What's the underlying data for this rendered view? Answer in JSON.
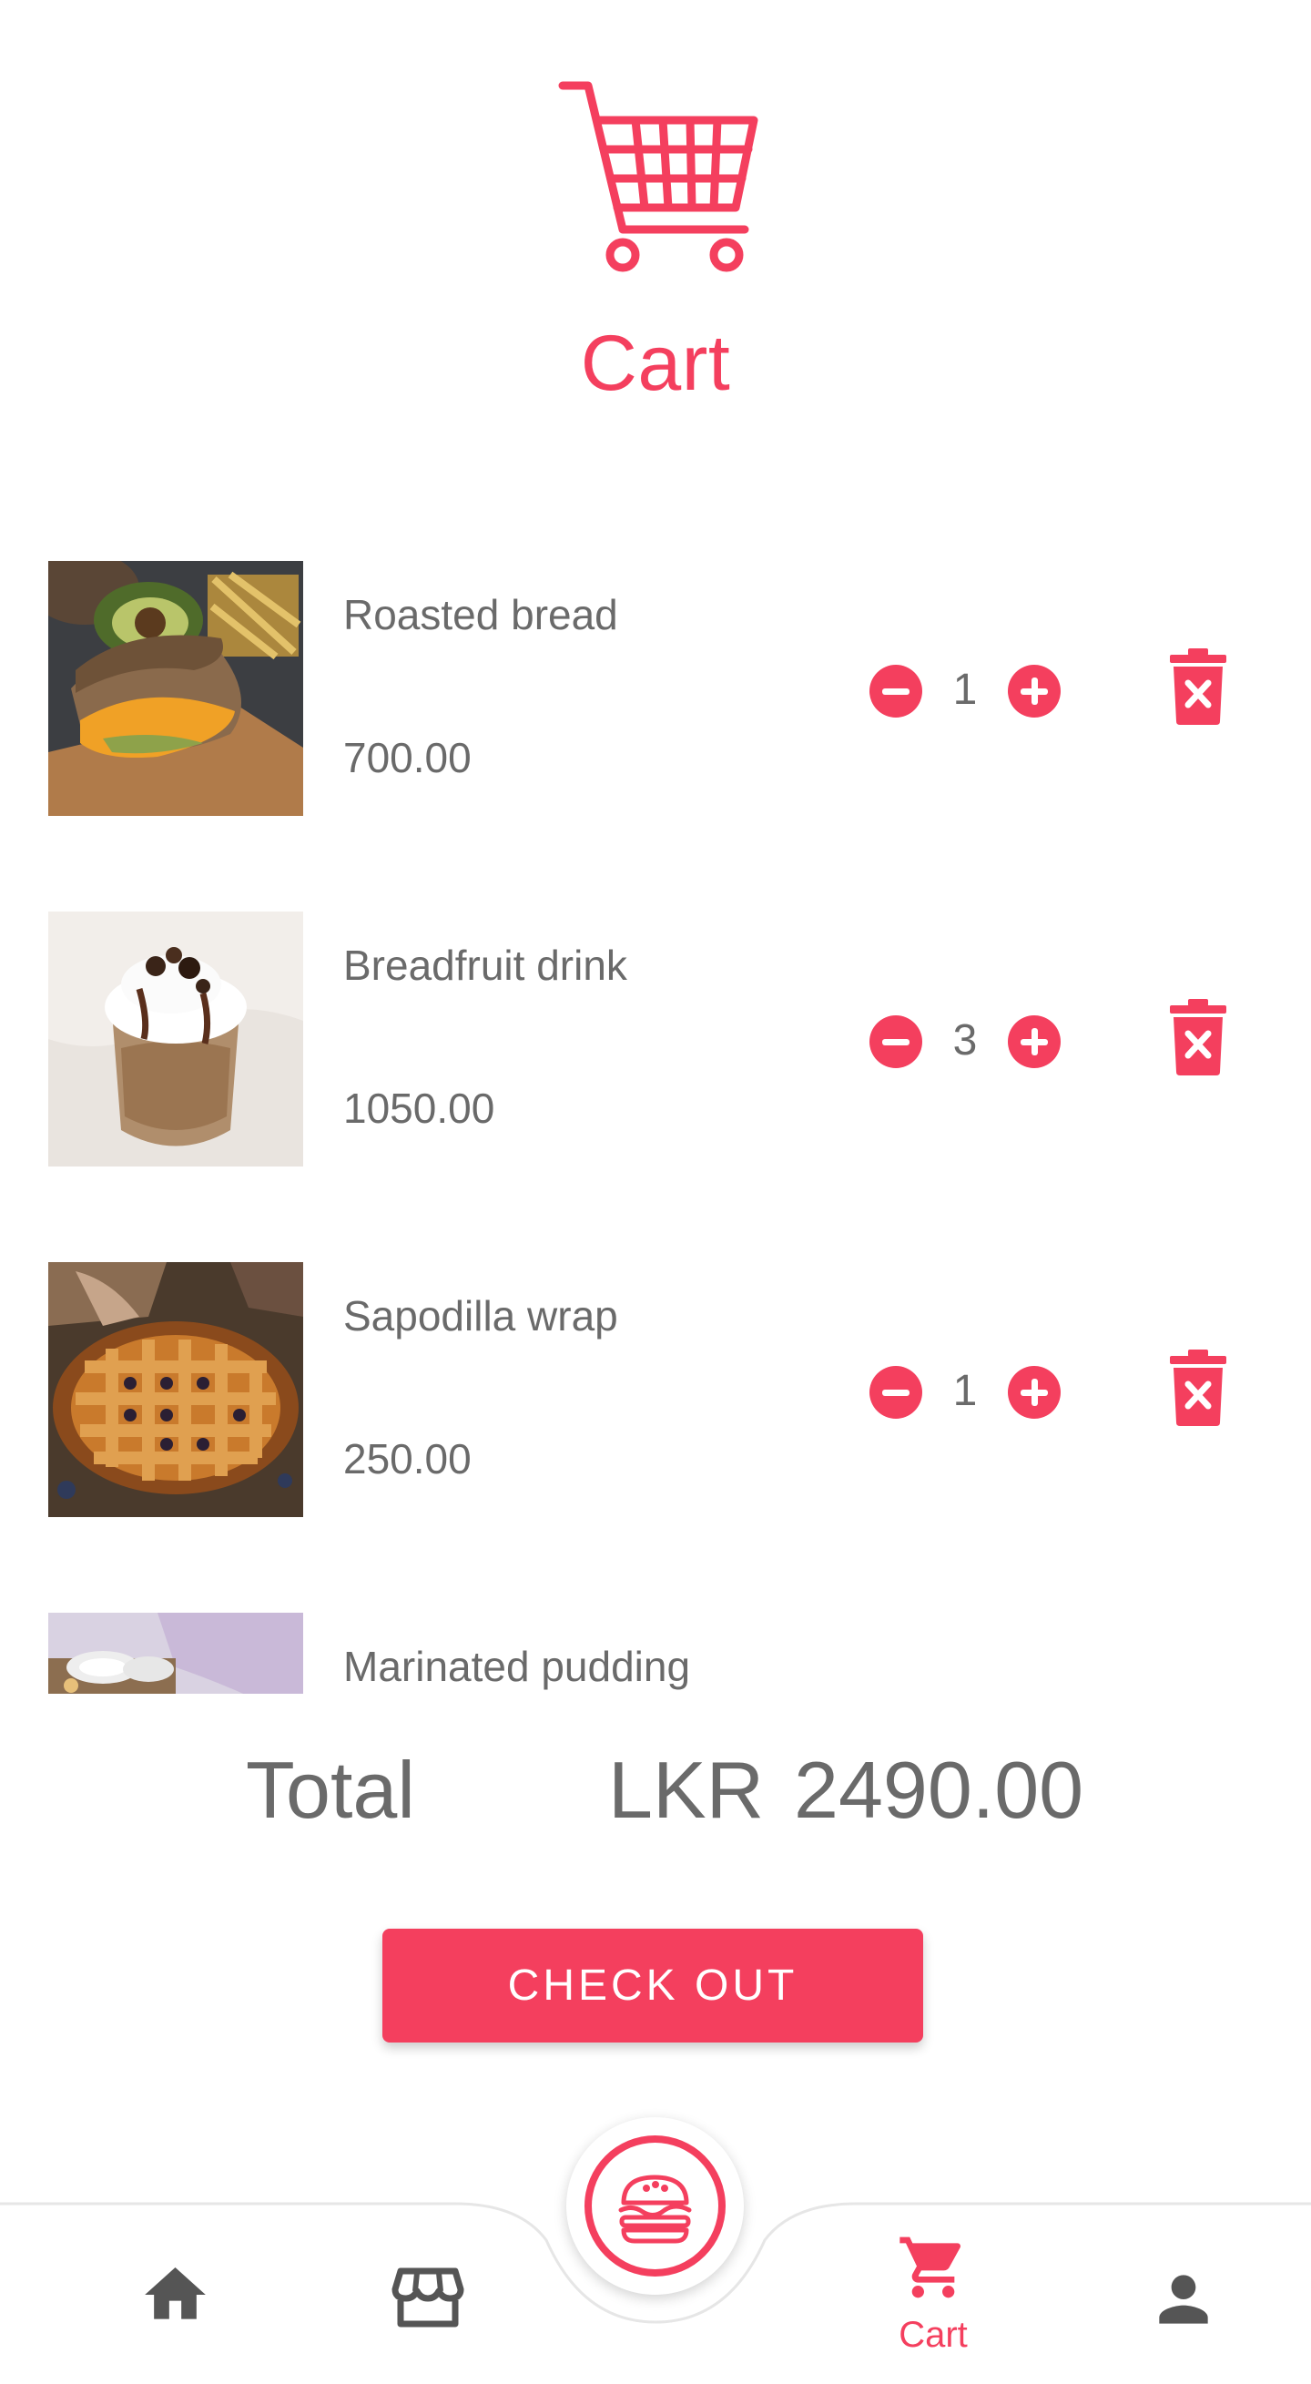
{
  "header": {
    "title": "Cart",
    "icon": "cart-icon"
  },
  "accent_color": "#F43F5E",
  "items": [
    {
      "name": "Roasted bread",
      "price": "700.00",
      "quantity": "1"
    },
    {
      "name": "Breadfruit drink",
      "price": "1050.00",
      "quantity": "3"
    },
    {
      "name": "Sapodilla wrap",
      "price": "250.00",
      "quantity": "1"
    },
    {
      "name": "Marinated pudding",
      "price": "",
      "quantity": ""
    }
  ],
  "total": {
    "label": "Total",
    "currency": "LKR",
    "amount": "2490.00"
  },
  "checkout_label": "CHECK OUT",
  "nav": {
    "home_icon": "home-icon",
    "store_icon": "store-icon",
    "center_icon": "burger-icon",
    "cart_label": "Cart",
    "profile_icon": "person-icon"
  }
}
